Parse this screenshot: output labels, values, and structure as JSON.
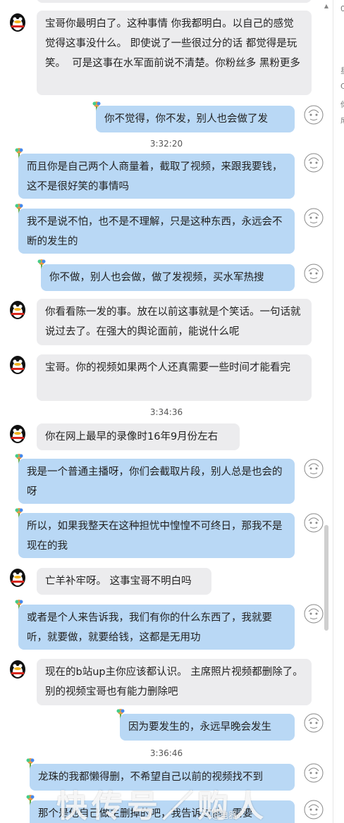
{
  "messages": [
    {
      "text": "宝哥你最明白了。这种事情 你我都明白。以自己的感觉 觉得这事没什么。 即使说了一些很过分的话 都觉得是玩笑。  可是这事在水军面前说不清楚。你粉丝多 黑粉更多"
    },
    {
      "text": "你不觉得，你不发，别人也会做了发"
    },
    {
      "text": "而且你是自己两个人商量着，截取了视频，来跟我要钱，这不是很好笑的事情吗"
    },
    {
      "text": "我不是说不怕，也不是不理解，只是这种东西，永远会不断的发生的"
    },
    {
      "text": "你不做，别人也会做，做了发视频，买水军热搜"
    },
    {
      "text": "你看看陈一发的事。放在以前这事就是个笑话。一句话就说过去了。在强大的舆论面前，能说什么呢"
    },
    {
      "text": "宝哥。你的视频如果两个人还真需要一些时间才能看完"
    },
    {
      "text": "你在网上最早的录像时16年9月份左右"
    },
    {
      "text": "我是一个普通主播呀，你们会截取片段，别人总是也会的呀"
    },
    {
      "text": "所以，如果我整天在这种担忧中惶惶不可终日，那我不是现在的我"
    },
    {
      "text": "亡羊补牢呀。 这事宝哥不明白吗"
    },
    {
      "text": "或者是个人来告诉我，我们有你的什么东西了，我就要听，就要做，就要给钱，这都是无用功"
    },
    {
      "text": "现在的b站up主你应该都认识。 主席照片视频都删除了。 别的视频宝哥也有能力删除吧"
    },
    {
      "text": "因为要发生的，永远早晚会发生"
    },
    {
      "text": "龙珠的我都懒得删，不希望自己以前的视频找不到"
    },
    {
      "text": "那个是他自己做主删掉的吧，我告诉过他，需要"
    }
  ],
  "timestamps": [
    "3:32:20",
    "3:34:36",
    "3:36:46"
  ],
  "sidebar": {
    "chars": [
      "星",
      "C",
      "你",
      "成"
    ],
    "top": "0"
  },
  "watermark": {
    "big": "快传号／购人",
    "small": "@电器"
  },
  "colors": {
    "incoming": "#ececee",
    "outgoing": "#b9d8f5"
  }
}
